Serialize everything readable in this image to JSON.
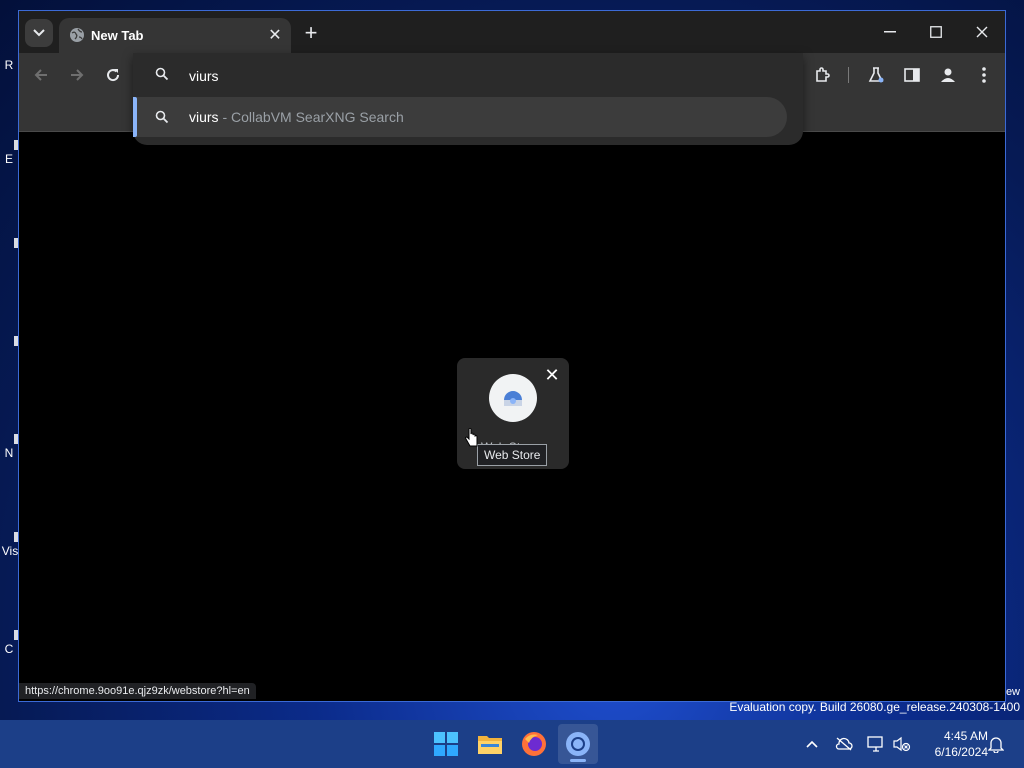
{
  "desktop": {
    "icon_fragments": [
      "R",
      "E",
      "N",
      "Vis",
      "C"
    ]
  },
  "browser": {
    "tab": {
      "title": "New Tab",
      "close_glyph": "✕"
    },
    "new_tab_glyph": "+",
    "omnibox": {
      "value": "viurs",
      "suggestion": {
        "query": "viurs",
        "separator": " - ",
        "engine": "CollabVM SearXNG Search"
      }
    },
    "shortcut": {
      "label": "Web Store",
      "partial_label": "Web St"
    },
    "tooltip": "Web Store",
    "status_url": "https://chrome.9oo91e.qjz9zk/webstore?hl=en",
    "accent_color": "#8ab4f8"
  },
  "watermark": {
    "fragment": "ew",
    "line": "Evaluation copy. Build 26080.ge_release.240308-1400"
  },
  "taskbar": {
    "apps": [
      "start-icon",
      "file-explorer-icon",
      "firefox-icon",
      "chrome-icon"
    ],
    "clock": {
      "time": "4:45 AM",
      "date": "6/16/2024"
    }
  }
}
